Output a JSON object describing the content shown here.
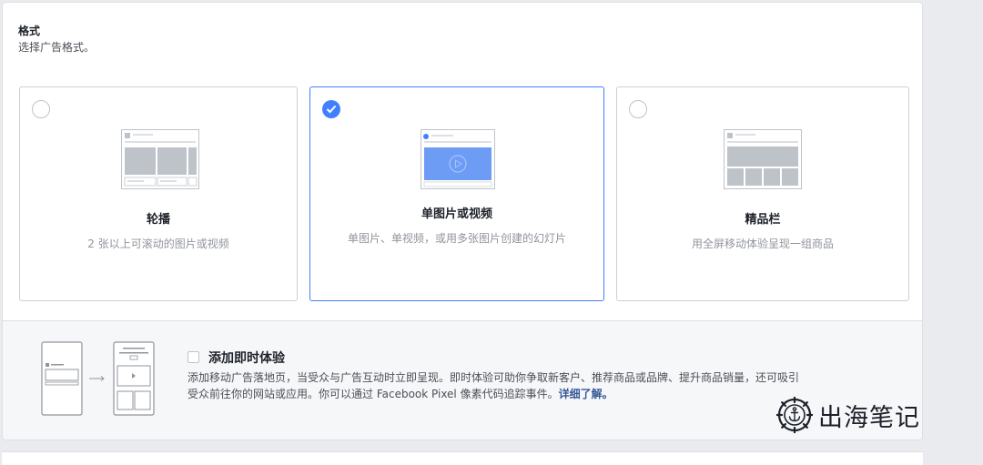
{
  "format": {
    "title": "格式",
    "subtitle": "选择广告格式。"
  },
  "cards": [
    {
      "title": "轮播",
      "description": "2 张以上可滚动的图片或视频",
      "selected": false
    },
    {
      "title": "单图片或视频",
      "description": "单图片、单视频，或用多张图片创建的幻灯片",
      "selected": true
    },
    {
      "title": "精品栏",
      "description": "用全屏移动体验呈现一组商品",
      "selected": false
    }
  ],
  "instant_experience": {
    "title": "添加即时体验",
    "description_line1": "添加移动广告落地页，当受众与广告互动时立即呈现。即时体验可助你争取新客户、推荐商品或品牌、提升商品销量，还可吸引",
    "description_line2": "受众前往你的网站或应用。你可以通过 Facebook Pixel 像素代码追踪事件。",
    "learn_more": "详细了解。",
    "checked": false
  },
  "watermark": {
    "text": "出海笔记",
    "icon": "ship-wheel-anchor-icon"
  },
  "colors": {
    "accent": "#4080ff",
    "link": "#365899",
    "border": "#ccd0d5"
  }
}
